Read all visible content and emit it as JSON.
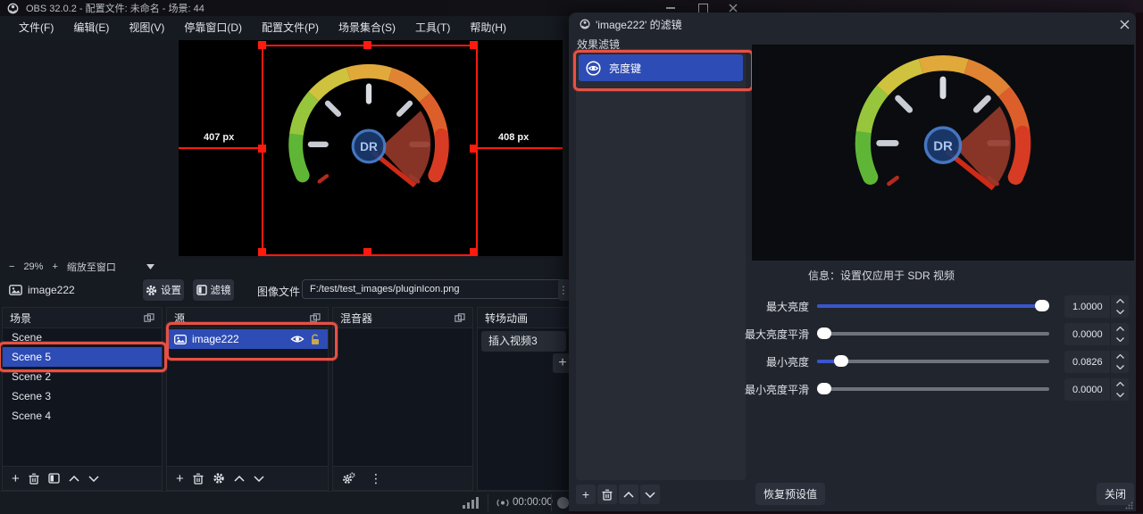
{
  "window": {
    "title": "OBS 32.0.2 - 配置文件: 未命名 - 场景: 44",
    "menu": [
      "文件(F)",
      "编辑(E)",
      "视图(V)",
      "停靠窗口(D)",
      "配置文件(P)",
      "场景集合(S)",
      "工具(T)",
      "帮助(H)"
    ]
  },
  "preview": {
    "dim_left": "407 px",
    "dim_right": "408 px",
    "zoom_out": "−",
    "zoom_level": "29%",
    "zoom_in": "+",
    "fit_label": "缩放至窗口"
  },
  "source_row": {
    "name": "image222",
    "settings_label": "设置",
    "filters_label": "滤镜",
    "file_label": "图像文件",
    "file_path": "F:/test/test_images/pluginIcon.png"
  },
  "panels": {
    "scenes": {
      "title": "场景",
      "items": [
        "Scene",
        "Scene 5",
        "Scene 2",
        "Scene 3",
        "Scene 4"
      ],
      "selected": "Scene 5"
    },
    "sources": {
      "title": "源",
      "items": [
        "image222"
      ]
    },
    "mixer": {
      "title": "混音器"
    },
    "transitions": {
      "title": "转场动画",
      "current": "插入视频3"
    }
  },
  "statusbar": {
    "timer": "00:00:00"
  },
  "dialog": {
    "title": "'image222' 的滤镜",
    "effects_label": "效果滤镜",
    "filters": [
      {
        "name": "亮度键"
      }
    ],
    "info": "信息：设置仅应用于 SDR 视频",
    "sliders": [
      {
        "label": "最大亮度",
        "value": "1.0000",
        "fraction": 1
      },
      {
        "label": "最大亮度平滑",
        "value": "0.0000",
        "fraction": 0
      },
      {
        "label": "最小亮度",
        "value": "0.0826",
        "fraction": 0.077
      },
      {
        "label": "最小亮度平滑",
        "value": "0.0000",
        "fraction": 0
      }
    ],
    "defaults_label": "恢复预设值",
    "close_label": "关闭"
  },
  "gauge": {
    "center_label": "DR"
  },
  "icons": {
    "plus": "+",
    "kebab": "⋮",
    "dropdown_arrow": "▼"
  },
  "colors": {
    "accent": "#2e4cb5",
    "annotation": "#e85043",
    "selection": "#ff1a0e"
  }
}
